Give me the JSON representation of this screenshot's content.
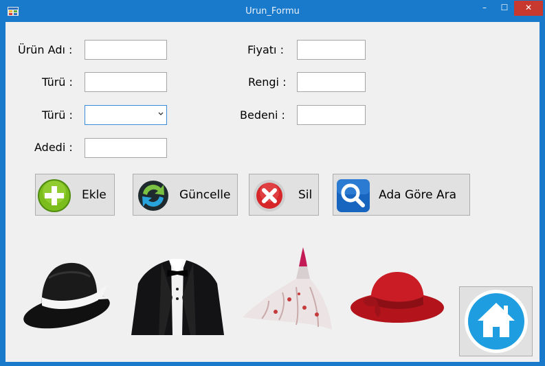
{
  "window": {
    "title": "Urun_Formu",
    "minimize": "–",
    "maximize": "☐",
    "close": "✕"
  },
  "form": {
    "labels": {
      "urun_adi": "Ürün Adı :",
      "turu1": "Türü :",
      "turu2": "Türü :",
      "adedi": "Adedi :",
      "fiyati": "Fiyatı :",
      "rengi": "Rengi :",
      "bedeni": "Bedeni :"
    },
    "values": {
      "urun_adi": "",
      "turu1": "",
      "turu2": "",
      "adedi": "",
      "fiyati": "",
      "rengi": "",
      "bedeni": ""
    }
  },
  "buttons": {
    "ekle": "Ekle",
    "guncelle": "Güncelle",
    "sil": "Sil",
    "ada_gore_ara": "Ada Göre  Ara"
  },
  "icons": {
    "app": "app-icon",
    "ekle": "plus-icon",
    "guncelle": "refresh-icon",
    "sil": "delete-icon",
    "ara": "search-icon",
    "home": "home-icon"
  },
  "images": [
    "fedora-hat",
    "tuxedo-suit",
    "evening-dress",
    "red-cloche-hat"
  ],
  "colors": {
    "titlebar": "#1979ca",
    "close": "#c7392f",
    "home": "#1e9ee0"
  }
}
